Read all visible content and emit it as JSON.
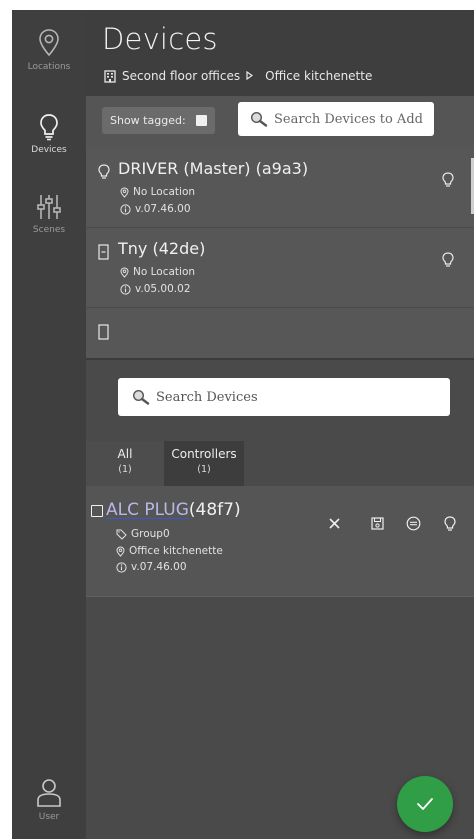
{
  "sidebar": {
    "items": [
      {
        "label": "Locations",
        "icon": "location-pin-icon",
        "active": false
      },
      {
        "label": "Devices",
        "icon": "lightbulb-icon",
        "active": true
      },
      {
        "label": "Scenes",
        "icon": "sliders-icon",
        "active": false
      }
    ],
    "user": {
      "label": "User",
      "icon": "user-icon"
    }
  },
  "header": {
    "title": "Devices",
    "breadcrumb": [
      "Second floor offices",
      "Office kitchenette"
    ]
  },
  "toolbar": {
    "show_tagged_label": "Show tagged:",
    "search_add_placeholder": "Search Devices to Add"
  },
  "device_list": [
    {
      "name": "DRIVER (Master) (a9a3)",
      "location": "No Location",
      "version": "v.07.46.00",
      "icon": "lightbulb-icon"
    },
    {
      "name": "Tny (42de)",
      "location": "No Location",
      "version": "v.05.00.02",
      "icon": "switch-icon"
    }
  ],
  "search_devices_placeholder": "Search Devices",
  "tabs": [
    {
      "label": "All",
      "count": "(1)"
    },
    {
      "label": "Controllers",
      "count": "(1)"
    }
  ],
  "selected_device": {
    "name_link": "ALC PLUG",
    "name_id": "(48f7)",
    "group": "Group0",
    "location": "Office kitchenette",
    "version": "v.07.46.00"
  },
  "colors": {
    "sidebar_bg": "#3f3f3f",
    "header_bg": "#3e3e3e",
    "panel_bg": "#555555",
    "fab_green": "#2f9e46",
    "link_underline": "#3a58c8"
  }
}
